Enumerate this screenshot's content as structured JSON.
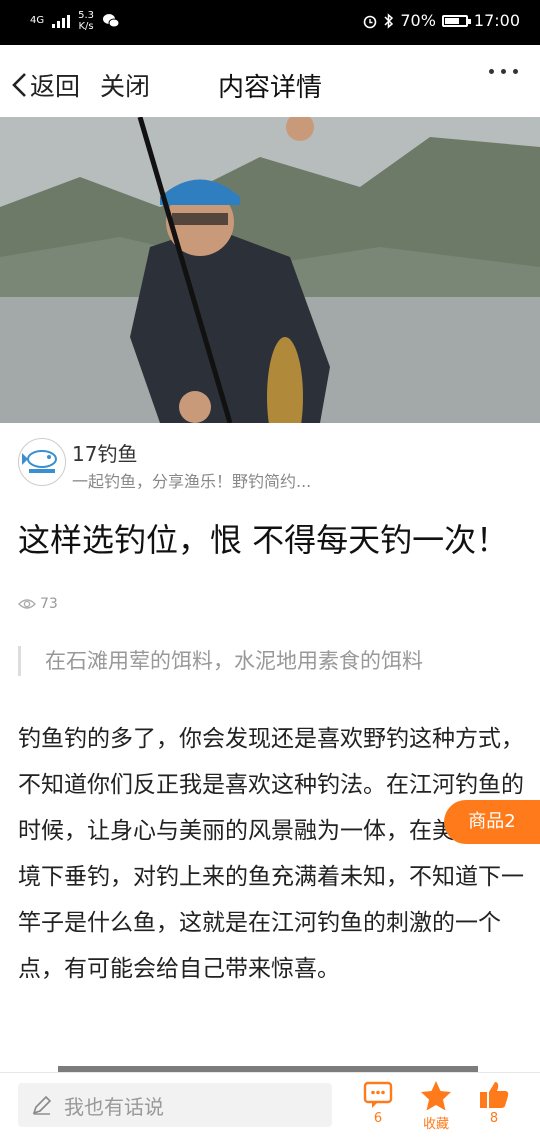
{
  "status_bar": {
    "network": "4G",
    "speed_value": "5.3",
    "speed_unit": "K/s",
    "battery": "70%",
    "battery_level": 0.7,
    "time": "17:00"
  },
  "nav": {
    "back_label": "返回",
    "close_label": "关闭",
    "title": "内容详情"
  },
  "author": {
    "name": "17钓鱼",
    "desc": "一起钓鱼，分享渔乐！野钓简约..."
  },
  "article": {
    "title": "这样选钓位，恨 不得每天钓一次！",
    "views": "73",
    "quote": "在石滩用荤的饵料，水泥地用素食的饵料",
    "paragraph": "钓鱼钓的多了，你会发现还是喜欢野钓这种方式，不知道你们反正我是喜欢这种钓法。在江河钓鱼的时候，让身心与美丽的风景融为一体，在美丽的环境下垂钓，对钓上来的鱼充满着未知，不知道下一竿子是什么鱼，这就是在江河钓鱼的刺激的一个点，有可能会给自己带来惊喜。"
  },
  "goods_button": "商品2",
  "bottom_bar": {
    "comment_placeholder": "我也有话说",
    "comment_count": "6",
    "favorite_label": "收藏",
    "like_count": "8",
    "accent_color": "#ff7a1a"
  }
}
